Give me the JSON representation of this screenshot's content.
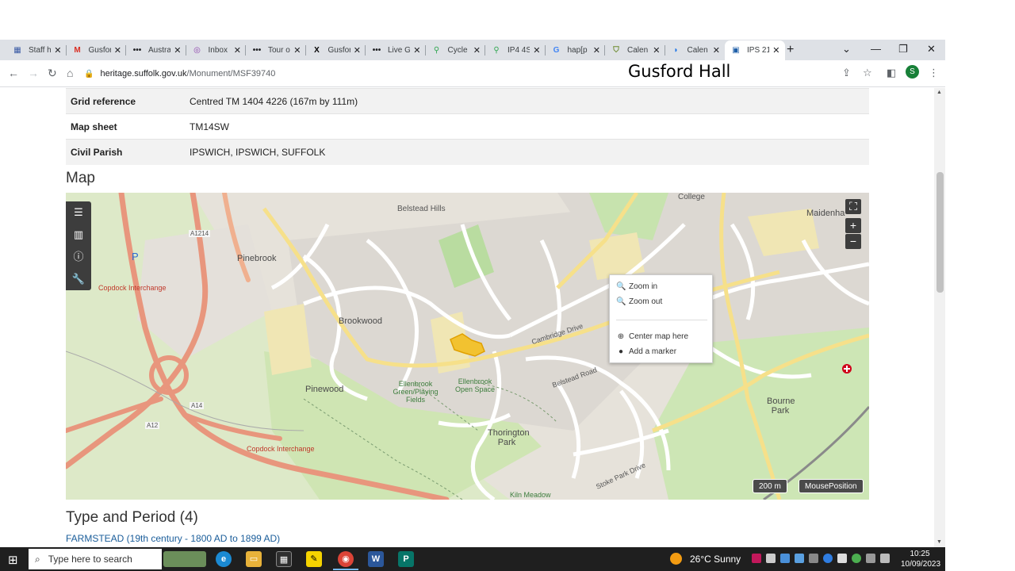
{
  "tabs": [
    {
      "label": "Staff h",
      "icon": "calendar-icon",
      "color": "#3b5ba5"
    },
    {
      "label": "Gusfor",
      "icon": "gmail-icon",
      "color": "#d93025"
    },
    {
      "label": "Austra",
      "icon": "dots-icon",
      "color": "#202124"
    },
    {
      "label": "Inbox",
      "icon": "inbox-icon",
      "color": "#8e44ad"
    },
    {
      "label": "Tour o",
      "icon": "dots-icon",
      "color": "#202124"
    },
    {
      "label": "Gusfor",
      "icon": "x-icon",
      "color": "#000000"
    },
    {
      "label": "Live G",
      "icon": "dots-icon",
      "color": "#202124"
    },
    {
      "label": "Cycle",
      "icon": "maps-pin-icon",
      "color": "#34a853"
    },
    {
      "label": "IP4 4S",
      "icon": "maps-pin-icon",
      "color": "#34a853"
    },
    {
      "label": "hap[p",
      "icon": "google-icon",
      "color": "#4285f4"
    },
    {
      "label": "Calen",
      "icon": "shield-icon",
      "color": "#6d8b2f"
    },
    {
      "label": "Calen",
      "icon": "signal-icon",
      "color": "#1a73e8"
    },
    {
      "label": "IPS 21",
      "icon": "page-icon",
      "color": "#1f5fa8"
    }
  ],
  "toolbar": {
    "url_host": "heritage.suffolk.gov.uk",
    "url_path": "/Monument/MSF39740",
    "annotation": "Gusford Hall",
    "profile_initial": "S"
  },
  "details": [
    {
      "key": "Grid reference",
      "value": "Centred TM 1404 4226 (167m by 111m)"
    },
    {
      "key": "Map sheet",
      "value": "TM14SW"
    },
    {
      "key": "Civil Parish",
      "value": "IPSWICH, IPSWICH, SUFFOLK"
    }
  ],
  "map": {
    "heading": "Map",
    "labels": {
      "belstead_hills": "Belstead Hills",
      "pinebrook": "Pinebrook",
      "brookwood": "Brookwood",
      "pinewood": "Pinewood",
      "thorington_park": "Thorington Park",
      "bourne_park": "Bourne Park",
      "maidenhall": "Maidenha",
      "college": "College",
      "copdock_interchange_top": "Copdock Interchange",
      "copdock_interchange_bottom": "Copdock Interchange",
      "a1214": "A1214",
      "a12": "A12",
      "a14": "A14",
      "ellenbrook_fields": "Ellenbrook Green/Playing Fields",
      "ellenbrook_open_space": "Ellenbrook Open Space",
      "cambridge_drive": "Cambridge Drive",
      "belstead_road": "Belstead Road",
      "kiln_meadow": "Kiln Meadow",
      "stoke_park_drive": "Stoke Park Drive",
      "parking": "P"
    },
    "context_menu": {
      "zoom_in": "Zoom in",
      "zoom_out": "Zoom out",
      "center": "Center map here",
      "add_marker": "Add a marker"
    },
    "scale": "200 m",
    "mouse_position": "MousePosition",
    "zoom_plus": "+",
    "zoom_minus": "−"
  },
  "type_period": {
    "heading": "Type and Period (4)",
    "first_item": "FARMSTEAD (19th century - 1800 AD to 1899 AD)"
  },
  "taskbar": {
    "search_placeholder": "Type here to search",
    "weather": "26°C  Sunny",
    "time": "10:25",
    "date": "10/09/2023"
  }
}
